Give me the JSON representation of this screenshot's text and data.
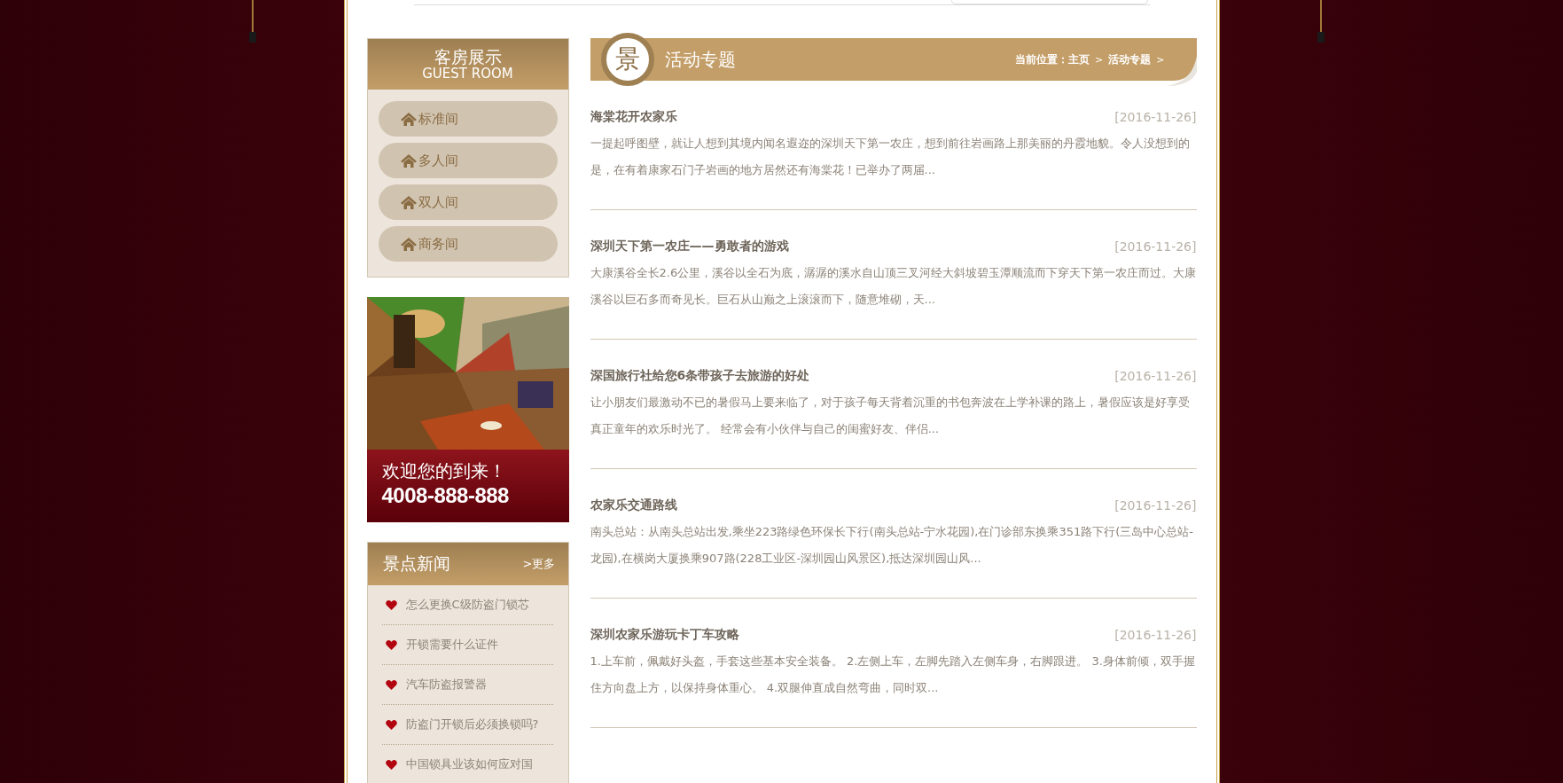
{
  "guest_room": {
    "title": "客房展示",
    "subtitle": "GUEST ROOM",
    "items": [
      {
        "label": "标准间"
      },
      {
        "label": "多人间"
      },
      {
        "label": "双人间"
      },
      {
        "label": "商务间"
      }
    ]
  },
  "banner": {
    "welcome": "欢迎您的到来！",
    "phone": "4008-888-888"
  },
  "news": {
    "title": "景点新闻",
    "more": ">更多",
    "items": [
      {
        "label": "怎么更换C级防盗门锁芯"
      },
      {
        "label": "开锁需要什么证件"
      },
      {
        "label": "汽车防盗报警器"
      },
      {
        "label": "防盗门开锁后必须换锁吗?"
      },
      {
        "label": "中国锁具业该如何应对国"
      }
    ]
  },
  "main": {
    "badge": "景",
    "title": "活动专题",
    "breadcrumb": [
      {
        "label": "当前位置：主页"
      },
      {
        "label": "活动专题"
      }
    ],
    "separator": ">",
    "articles": [
      {
        "title": "海棠花开农家乐",
        "date": "[2016-11-26]",
        "summary": "一提起呼图壁，就让人想到其境内闻名遐迩的深圳天下第一农庄，想到前往岩画路上那美丽的丹霞地貌。令人没想到的是，在有着康家石门子岩画的地方居然还有海棠花！已举办了两届..."
      },
      {
        "title": "深圳天下第一农庄——勇敢者的游戏",
        "date": "[2016-11-26]",
        "summary": "大康溪谷全长2.6公里，溪谷以全石为底，潺潺的溪水自山顶三叉河经大斜坡碧玉潭顺流而下穿天下第一农庄而过。大康溪谷以巨石多而奇见长。巨石从山巅之上滚滚而下，随意堆砌，天..."
      },
      {
        "title": "深国旅行社给您6条带孩子去旅游的好处",
        "date": "[2016-11-26]",
        "summary": "让小朋友们最激动不已的暑假马上要来临了，对于孩子每天背着沉重的书包奔波在上学补课的路上，暑假应该是好享受真正童年的欢乐时光了。 经常会有小伙伴与自己的闺蜜好友、伴侣..."
      },
      {
        "title": "农家乐交通路线",
        "date": "[2016-11-26]",
        "summary": "南头总站：从南头总站出发,乘坐223路绿色环保长下行(南头总站-宁水花园),在门诊部东换乘351路下行(三岛中心总站-龙园),在横岗大厦换乘907路(228工业区-深圳园山风景区),抵达深圳园山风..."
      },
      {
        "title": "深圳农家乐游玩卡丁车攻略",
        "date": "[2016-11-26]",
        "summary": "1.上车前，佩戴好头盔，手套这些基本安全装备。 2.左侧上车，左脚先踏入左侧车身，右脚跟进。 3.身体前倾，双手握住方向盘上方，以保持身体重心。 4.双腿伸直成自然弯曲，同时双..."
      }
    ]
  }
}
